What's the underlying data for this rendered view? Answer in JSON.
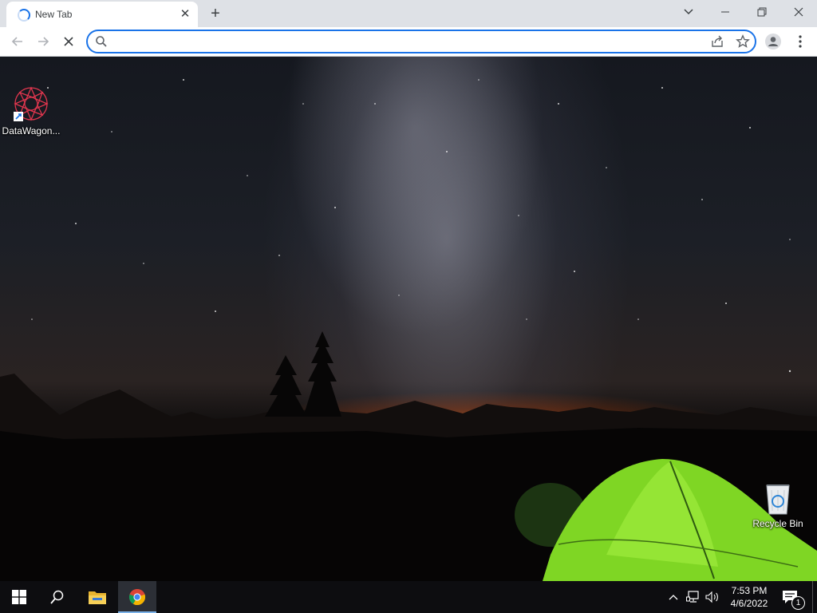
{
  "browser": {
    "tab": {
      "title": "New Tab",
      "loading": true
    },
    "omnibox": {
      "value": "",
      "placeholder": ""
    },
    "accent": "#1a73e8"
  },
  "desktop": {
    "icons": [
      {
        "label": "DataWagon...",
        "icon": "datawagon-app-icon",
        "shortcut": true
      },
      {
        "label": "Recycle Bin",
        "icon": "recycle-bin-icon"
      }
    ],
    "wallpaper": "night sky with milky way, mountains and green tent"
  },
  "taskbar": {
    "pinned": [
      {
        "name": "start-button",
        "icon": "windows-logo-icon"
      },
      {
        "name": "search-button",
        "icon": "search-icon"
      },
      {
        "name": "file-explorer-button",
        "icon": "folder-icon"
      },
      {
        "name": "chrome-button",
        "icon": "chrome-icon",
        "active": true
      }
    ],
    "clock": {
      "time": "7:53 PM",
      "date": "4/6/2022"
    },
    "notifications": {
      "count": "1"
    }
  }
}
